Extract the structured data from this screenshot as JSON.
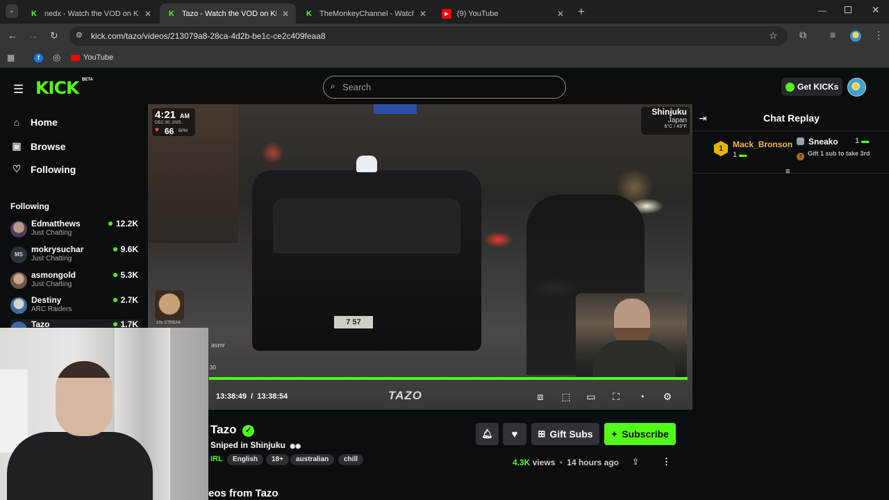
{
  "browser": {
    "tabs": [
      {
        "title": "nedx - Watch the VOD on Kick",
        "close": "✕"
      },
      {
        "title": "Tazo - Watch the VOD on Kick",
        "close": "✕"
      },
      {
        "title": "TheMonkeyChannel - Watch the",
        "close": "✕"
      },
      {
        "title": "(9) YouTube",
        "close": "✕"
      }
    ],
    "new_tab": "+",
    "url": "kick.com/tazo/videos/213079a8-28ca-4d2b-be1c-ce2c409feaa8",
    "bookmarks": [
      {
        "label": "YouTube"
      }
    ]
  },
  "header": {
    "logo": "KICK",
    "beta": "BETA",
    "search_placeholder": "Search",
    "get_kicks": "Get KICKs"
  },
  "sidebar": {
    "nav": [
      {
        "label": "Home",
        "icon": "home-icon"
      },
      {
        "label": "Browse",
        "icon": "browse-icon"
      },
      {
        "label": "Following",
        "icon": "heart-icon"
      }
    ],
    "following_heading": "Following",
    "channels": [
      {
        "name": "Edmatthews",
        "category": "Just Chatting",
        "viewers": "12.2K"
      },
      {
        "name": "mokrysuchar",
        "category": "Just Chatting",
        "viewers": "9.6K",
        "initials": "MS"
      },
      {
        "name": "asmongold",
        "category": "Just Chatting",
        "viewers": "5.3K"
      },
      {
        "name": "Destiny",
        "category": "ARC Raiders",
        "viewers": "2.7K"
      },
      {
        "name": "Tazo",
        "category": "",
        "viewers": "1.7K"
      }
    ]
  },
  "video": {
    "overlay_time": "4:21",
    "overlay_ampm": "AM",
    "overlay_date": "DEC 30, 2025",
    "overlay_bpm": "66",
    "overlay_bpm_unit": "BPM",
    "location_city": "Shinjuku",
    "location_country": "Japan",
    "weather": "6°C / 43°F",
    "streak_label": "10x STREAK",
    "side_label": "asmr",
    "side_num": "30",
    "taxi_plate": "7 57",
    "current_time": "13:38:49",
    "separator": "/",
    "duration": "13:38:54",
    "progress": 0.99,
    "watermark": "TAZO"
  },
  "chat": {
    "title": "Chat Replay",
    "leaderboard": [
      {
        "rank": "1",
        "name": "Mack_Bronson",
        "count": "1"
      },
      {
        "name": "Sneako",
        "count": "1",
        "cta": "Gift 1 sub to take 3rd",
        "rank": "3"
      }
    ]
  },
  "stream": {
    "channel": "Tazo",
    "title": "Sniped in Shinjuku",
    "category": "IRL",
    "tags": [
      "English",
      "18+",
      "australian",
      "chill"
    ],
    "views": "4.3K",
    "views_label": "views",
    "ago": "14 hours ago",
    "gift_subs": "Gift Subs",
    "subscribe": "Subscribe",
    "more_videos": "eos from Tazo"
  },
  "colors": {
    "accent": "#53fc18",
    "bg": "#0b0e0f"
  }
}
